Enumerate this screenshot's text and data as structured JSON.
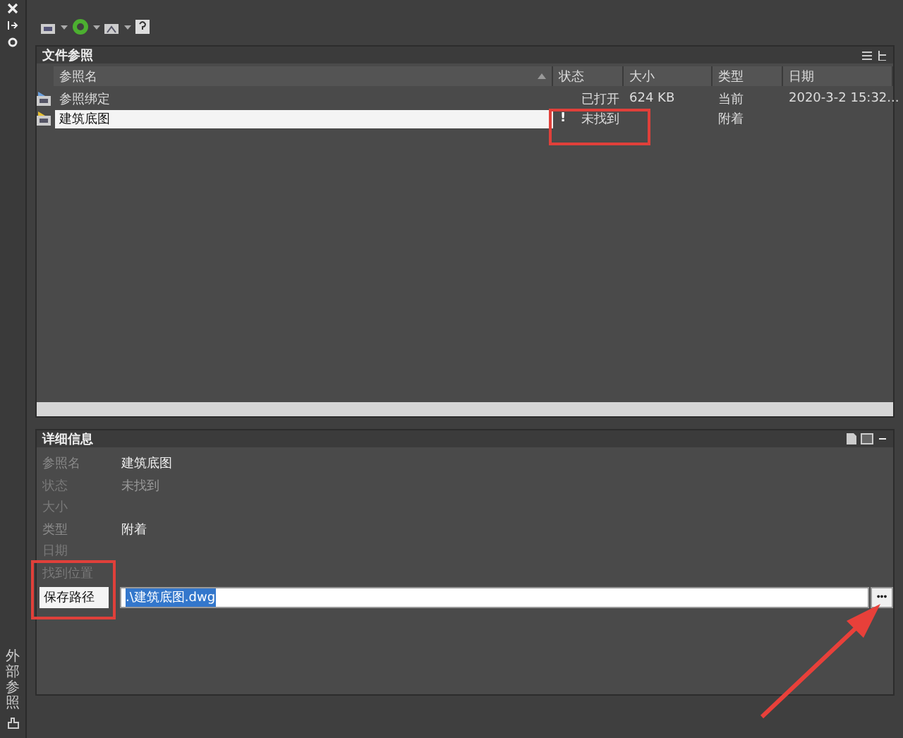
{
  "side_strip": {
    "title": "外部参照"
  },
  "file_refs": {
    "title": "文件参照",
    "columns": [
      {
        "label": "参照名",
        "sorted": true
      },
      {
        "label": "状态",
        "sorted": false
      },
      {
        "label": "大小",
        "sorted": false
      },
      {
        "label": "类型",
        "sorted": false
      },
      {
        "label": "日期",
        "sorted": false
      }
    ],
    "rows": [
      {
        "name": "参照绑定",
        "kind": "current",
        "status": "已打开",
        "size": "624 KB",
        "type": "当前",
        "date": "2020-3-2 15:32...",
        "selected": false
      },
      {
        "name": "建筑底图",
        "kind": "attach",
        "warning": "!",
        "status": "未找到",
        "type": "附着",
        "selected": true
      }
    ]
  },
  "details": {
    "title": "详细信息",
    "fields": [
      {
        "label": "参照名",
        "value": "建筑底图",
        "enabled": true
      },
      {
        "label": "状态",
        "value": "未找到",
        "enabled": false
      },
      {
        "label": "大小",
        "enabled": false
      },
      {
        "label": "类型",
        "value": "附着",
        "enabled": true
      },
      {
        "label": "日期",
        "enabled": false
      },
      {
        "label": "找到位置",
        "enabled": false
      }
    ],
    "save_path": {
      "label": "保存路径",
      "value": ".\\建筑底图.dwg",
      "browse": "•••"
    }
  }
}
